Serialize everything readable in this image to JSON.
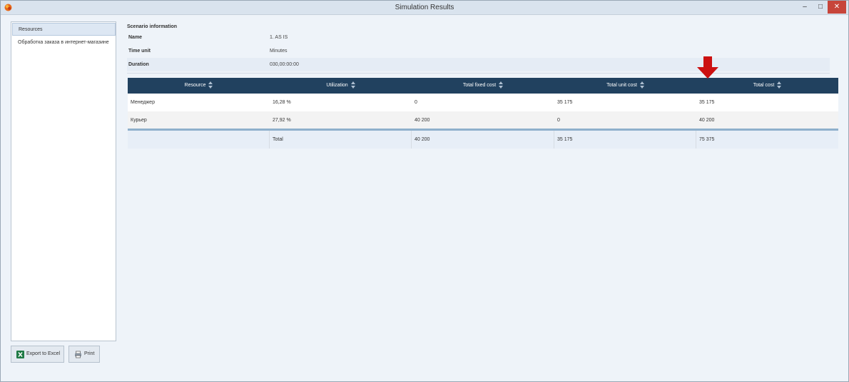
{
  "window": {
    "title": "Simulation Results",
    "minimize": "–",
    "maximize": "□",
    "close": "✕"
  },
  "sidebar": {
    "items": [
      {
        "label": "Resources",
        "active": true
      },
      {
        "label": "Обработка заказа в интернет-магазине",
        "active": false
      }
    ]
  },
  "buttons": {
    "export": "Export to Excel",
    "print": "Print"
  },
  "scenario": {
    "heading": "Scenario information",
    "rows": [
      {
        "label": "Name",
        "value": "1. AS IS"
      },
      {
        "label": "Time unit",
        "value": "Minutes"
      },
      {
        "label": "Duration",
        "value": "030,00:00:00"
      }
    ]
  },
  "table": {
    "columns": [
      "Resource",
      "Utilization",
      "Total fixed cost",
      "Total unit cost",
      "Total cost"
    ],
    "rows": [
      [
        "Менеджер",
        "16,28 %",
        "0",
        "35 175",
        "35 175"
      ],
      [
        "Курьер",
        "27,92 %",
        "40 200",
        "0",
        "40 200"
      ]
    ],
    "total": [
      "",
      "Total",
      "40 200",
      "35 175",
      "75 375"
    ]
  },
  "colors": {
    "header": "#21415f",
    "arrow": "#cc1111",
    "accent_bar": "#8fb0cc"
  }
}
